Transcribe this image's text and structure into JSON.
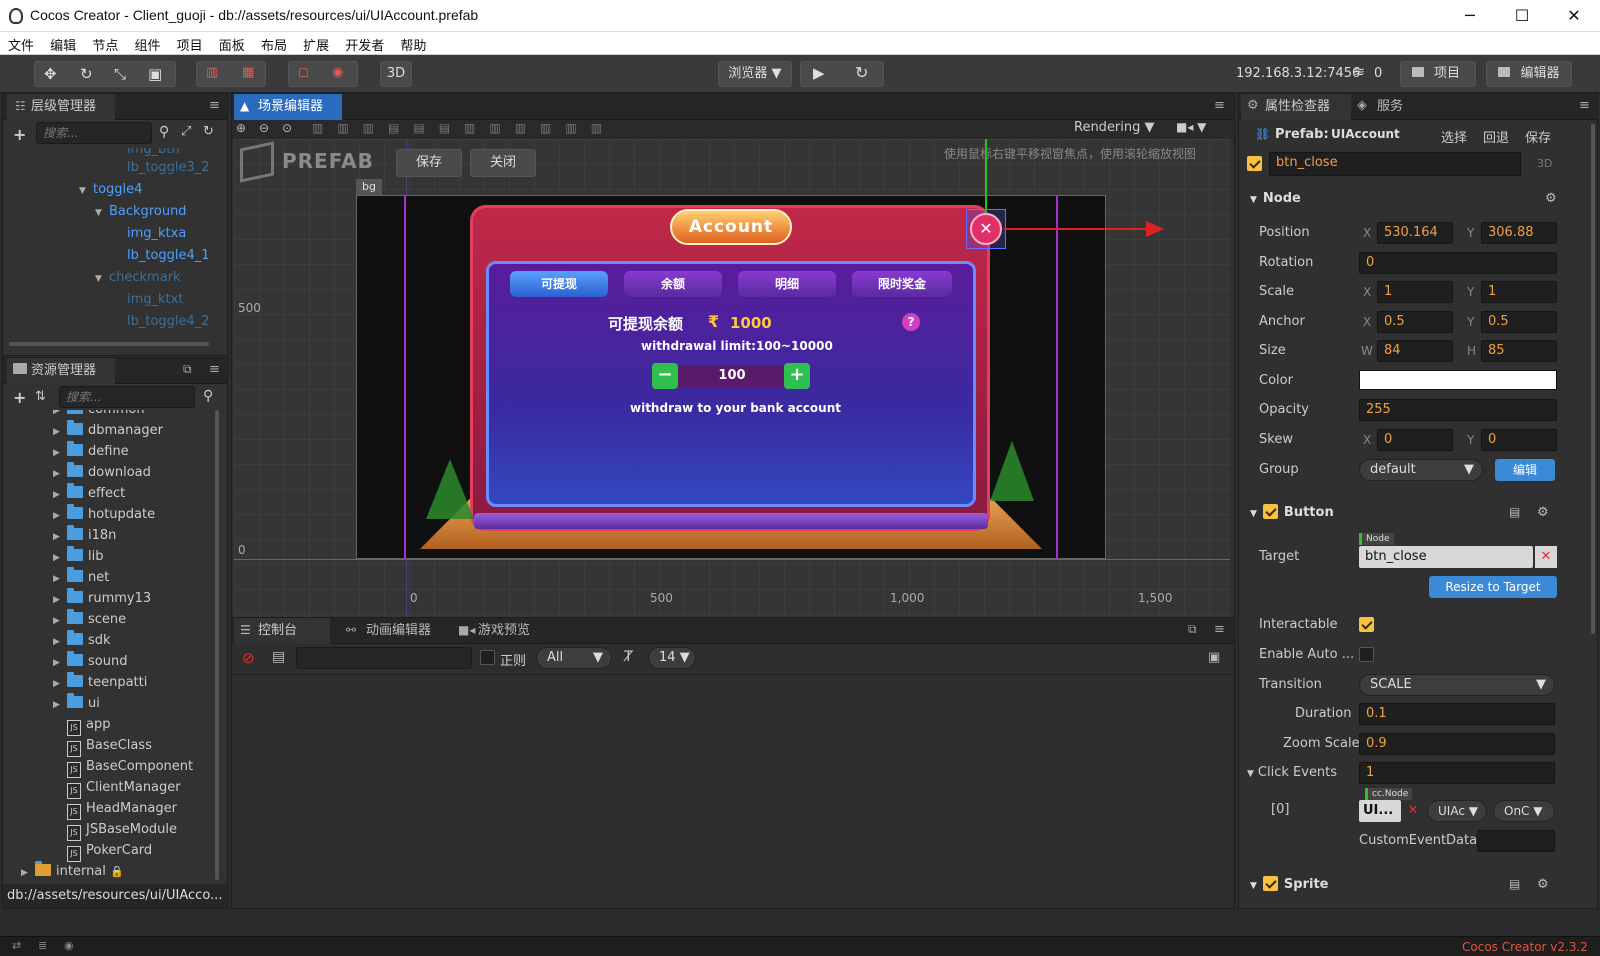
{
  "window": {
    "title": "Cocos Creator - Client_guoji - db://assets/resources/ui/UIAccount.prefab",
    "minimize": "─",
    "maximize": "☐",
    "close": "✕"
  },
  "menu": [
    "文件",
    "编辑",
    "节点",
    "组件",
    "项目",
    "面板",
    "布局",
    "扩展",
    "开发者",
    "帮助"
  ],
  "toolbar": {
    "mode3d": "3D",
    "browser": "浏览器 ▼",
    "ip": "192.168.3.12:7456",
    "conn_count": "0",
    "project_btn": "项目",
    "editor_btn": "编辑器"
  },
  "hierarchy": {
    "tab": "层级管理器",
    "search_placeholder": "搜索...",
    "items": [
      {
        "label": "img_btn",
        "style": "dim"
      },
      {
        "label": "lb_toggle3_2",
        "style": "dim"
      },
      {
        "label": "toggle4",
        "style": "blue"
      },
      {
        "label": "Background",
        "style": "blue"
      },
      {
        "label": "img_ktxa",
        "style": "blue"
      },
      {
        "label": "lb_toggle4_1",
        "style": "blue"
      },
      {
        "label": "checkmark",
        "style": "dim"
      },
      {
        "label": "img_ktxt",
        "style": "dim"
      },
      {
        "label": "lb_toggle4_2",
        "style": "dim"
      }
    ]
  },
  "assets": {
    "tab": "资源管理器",
    "search_placeholder": "搜索...",
    "folders": [
      "common",
      "dbmanager",
      "define",
      "download",
      "effect",
      "hotupdate",
      "i18n",
      "lib",
      "net",
      "rummy13",
      "scene",
      "sdk",
      "sound",
      "teenpatti",
      "ui"
    ],
    "scripts": [
      "app",
      "BaseClass",
      "BaseComponent",
      "ClientManager",
      "HeadManager",
      "JSBaseModule",
      "PokerCard"
    ],
    "internal": "internal",
    "path": "db://assets/resources/ui/UIAcco..."
  },
  "scene": {
    "tab": "场景编辑器",
    "rendering": "Rendering",
    "prefab_label": "PREFAB",
    "save_btn": "保存",
    "close_btn": "关闭",
    "hint": "使用鼠标右键平移视窗焦点，使用滚轮缩放视图",
    "bg_tag": "bg",
    "y_labels": [
      "500",
      "0"
    ],
    "x_labels": [
      "0",
      "500",
      "1,000",
      "1,500"
    ],
    "game": {
      "title": "Account",
      "tabs": [
        "可提现",
        "余额",
        "明细",
        "限时奖金"
      ],
      "balance_label": "可提现余额",
      "currency": "₹",
      "balance": "1000",
      "limit": "withdrawal limit:100~10000",
      "amount": "100",
      "minus": "−",
      "plus": "+",
      "help": "?",
      "withdraw_text": "withdraw to your bank account",
      "close_x": "✕"
    }
  },
  "console": {
    "tabs": [
      "控制台",
      "动画编辑器",
      "游戏预览"
    ],
    "regex_label": "正则",
    "filter": "All",
    "font_size": "14"
  },
  "inspector": {
    "tabs": [
      "属性检查器",
      "服务"
    ],
    "prefab_label": "Prefab:",
    "prefab_name": "UIAccount",
    "actions": [
      "选择",
      "回退",
      "保存"
    ],
    "node_name": "btn_close",
    "node_3d": "3D",
    "node_section": "Node",
    "props": {
      "position": {
        "label": "Position",
        "x": "530.164",
        "y": "306.88"
      },
      "rotation": {
        "label": "Rotation",
        "value": "0"
      },
      "scale": {
        "label": "Scale",
        "x": "1",
        "y": "1"
      },
      "anchor": {
        "label": "Anchor",
        "x": "0.5",
        "y": "0.5"
      },
      "size": {
        "label": "Size",
        "w": "84",
        "h": "85"
      },
      "color": {
        "label": "Color",
        "value": "#ffffff"
      },
      "opacity": {
        "label": "Opacity",
        "value": "255"
      },
      "skew": {
        "label": "Skew",
        "x": "0",
        "y": "0"
      },
      "group": {
        "label": "Group",
        "value": "default",
        "edit": "编辑"
      }
    },
    "button_section": "Button",
    "button": {
      "target_label": "Target",
      "target_tag": "Node",
      "target_value": "btn_close",
      "resize_btn": "Resize to Target",
      "interactable_label": "Interactable",
      "interactable": true,
      "enable_auto_label": "Enable Auto ...",
      "enable_auto": false,
      "transition_label": "Transition",
      "transition": "SCALE",
      "duration_label": "Duration",
      "duration": "0.1",
      "zoom_label": "Zoom Scale",
      "zoom": "0.9",
      "click_events_label": "Click Events",
      "click_events": "1",
      "event_index": "[0]",
      "event_tag": "cc.Node",
      "event_node": "UI...",
      "event_comp": "UIAc ▼",
      "event_handler": "OnC ▼",
      "custom_label": "CustomEventData"
    },
    "sprite_section": "Sprite",
    "xl": "X",
    "yl": "Y",
    "wl": "W",
    "hl": "H"
  },
  "status": {
    "version": "Cocos Creator v2.3.2"
  },
  "colors": {
    "accent": "#2a6bbf",
    "orange": "#f0a040",
    "version": "#e0533e"
  }
}
